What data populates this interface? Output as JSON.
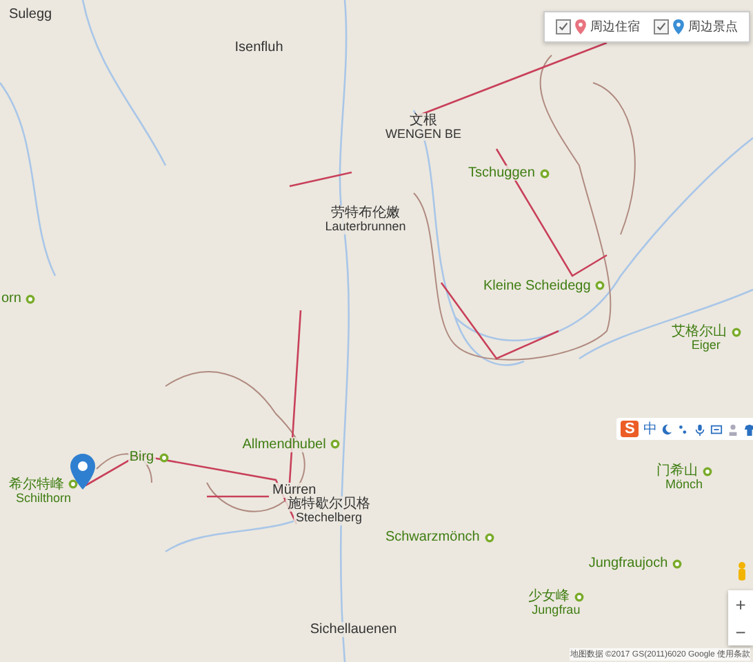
{
  "filter_panel": [
    {
      "label": "周边住宿",
      "checked": true,
      "kind": "lodging"
    },
    {
      "label": "周边景点",
      "checked": true,
      "kind": "attraction"
    }
  ],
  "places": [
    {
      "kind": "plain",
      "name": "Sulegg"
    },
    {
      "kind": "plain",
      "name": "Isenfluh"
    },
    {
      "kind": "plain",
      "name": "文根",
      "sub": "WENGEN BE"
    },
    {
      "kind": "poi",
      "name": "Tschuggen"
    },
    {
      "kind": "plain",
      "name": "劳特布伦嫩",
      "sub": "Lauterbrunnen"
    },
    {
      "kind": "poi",
      "name": "Kleine Scheidegg"
    },
    {
      "kind": "poi",
      "name": "orn"
    },
    {
      "kind": "poi",
      "name": "艾格尔山",
      "sub": "Eiger"
    },
    {
      "kind": "poi",
      "name": "Allmendhubel"
    },
    {
      "kind": "poi",
      "name": "Birg"
    },
    {
      "kind": "poi",
      "name": "门希山",
      "sub": "Mönch"
    },
    {
      "kind": "poi",
      "name": "希尔特峰",
      "sub": "Schilthorn"
    },
    {
      "kind": "plain",
      "name": "Mürren"
    },
    {
      "kind": "plain",
      "name": "施特歇尔贝格",
      "sub": "Stechelberg"
    },
    {
      "kind": "poi",
      "name": "Schwarzmönch"
    },
    {
      "kind": "poi",
      "name": "Jungfraujoch"
    },
    {
      "kind": "poi",
      "name": "少女峰",
      "sub": "Jungfrau"
    },
    {
      "kind": "plain",
      "name": "Sichellauenen"
    }
  ],
  "ime_toolbar": {
    "logo": "S",
    "mode": "中"
  },
  "zoom_controls": {
    "zoom_in": "+",
    "zoom_out": "−"
  },
  "attribution": "地图数据 ©2017 GS(2011)6020 Google  使用条款"
}
